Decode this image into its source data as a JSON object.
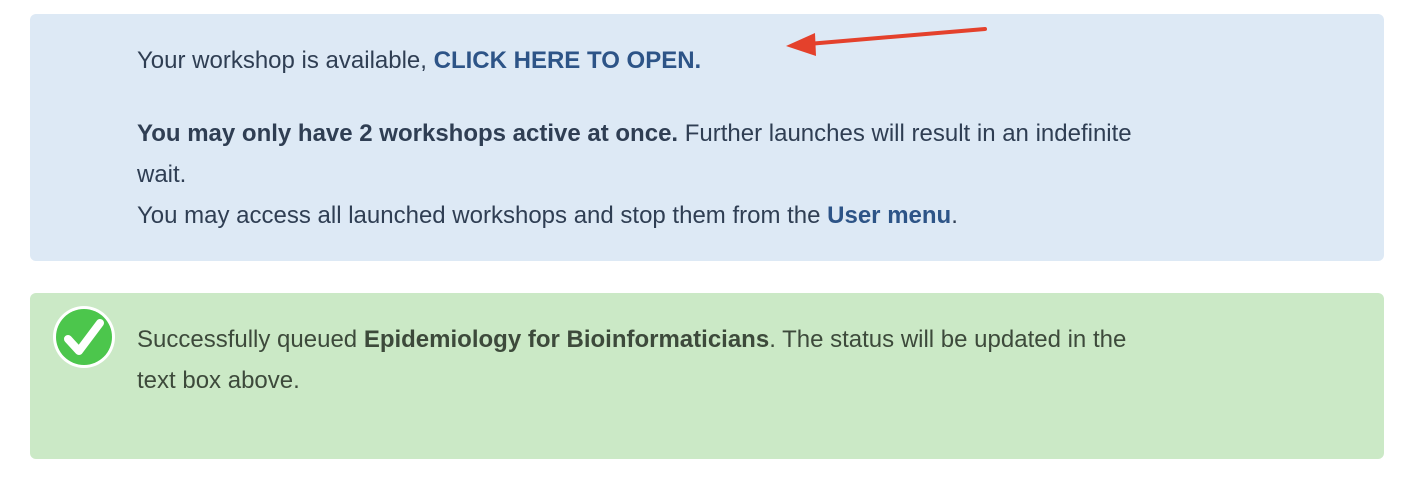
{
  "info": {
    "availability_prefix": "Your workshop is available, ",
    "open_link": "CLICK HERE TO OPEN.",
    "limit_bold": "You may only have 2 workshops active at once.",
    "limit_rest": " Further launches will result in an indefinite",
    "limit_wrap": "wait.",
    "access_prefix": "You may access all launched workshops and stop them from the ",
    "user_menu_link": "User menu",
    "access_suffix": "."
  },
  "success": {
    "icon": "check-circle-icon",
    "prefix": "Successfully queued ",
    "workshop_name": "Epidemiology for Bioinformaticians",
    "suffix": ". The status will be updated in the",
    "wrap": "text box above."
  },
  "colors": {
    "info_background": "#dde9f5",
    "success_background": "#cbe9c6",
    "link": "#2d5487",
    "check_green": "#4cc64c",
    "annotation_arrow": "#e4412c"
  }
}
